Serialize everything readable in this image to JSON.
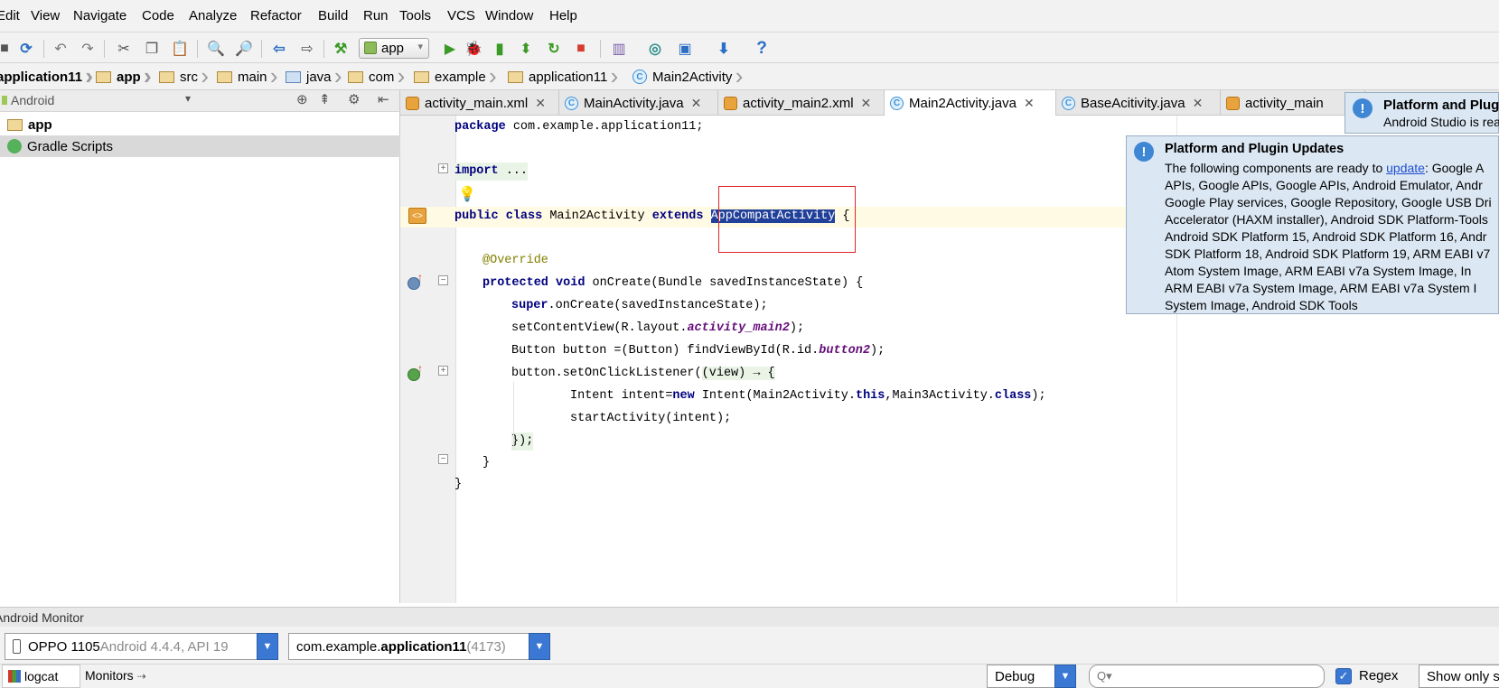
{
  "menu": [
    "Edit",
    "View",
    "Navigate",
    "Code",
    "Analyze",
    "Refactor",
    "Build",
    "Run",
    "Tools",
    "VCS",
    "Window",
    "Help"
  ],
  "menu_display": [
    "Edit",
    "View",
    "Navigate",
    "Code",
    "Analyze",
    "Refactor",
    "Build",
    "Run",
    "Tools",
    "VCS",
    "Window",
    "Help"
  ],
  "toolbar": {
    "run_config": "app",
    "help": "?"
  },
  "breadcrumbs": [
    "application11",
    "app",
    "src",
    "main",
    "java",
    "com",
    "example",
    "application11",
    "Main2Activity"
  ],
  "project_view": {
    "mode": "Android",
    "items": [
      "app",
      "Gradle Scripts"
    ]
  },
  "tabs": [
    "activity_main.xml",
    "MainActivity.java",
    "activity_main2.xml",
    "Main2Activity.java",
    "BaseAcitivity.java",
    "activity_main"
  ],
  "active_tab": "Main2Activity.java",
  "code": {
    "l1_kw": "package",
    "l1_rest": " com.example.application11;",
    "l2_kw": "import",
    "l2_rest": " ...",
    "l3_kw1": "public class",
    "l3_name": " Main2Activity ",
    "l3_kw2": "extends",
    "l3_sel": "AppCompatActivity",
    "l3_end": " {",
    "l4": "@Override",
    "l5_kw": "protected void",
    "l5_rest": " onCreate(Bundle savedInstanceState) {",
    "l6_kw": "super",
    "l6_rest": ".onCreate(savedInstanceState);",
    "l7_a": "setContentView(R.layout.",
    "l7_fld": "activity_main2",
    "l7_b": ");",
    "l8_a": "Button button =(Button) findViewById(R.id.",
    "l8_fld": "button2",
    "l8_b": ");",
    "l9_a": "button.setOnClickListener(",
    "l9_b": "(view) → {",
    "l10_a": "Intent intent=",
    "l10_kw1": "new",
    "l10_b": " Intent(Main2Activity.",
    "l10_kw2": "this",
    "l10_c": ",Main3Activity.",
    "l10_kw3": "class",
    "l10_d": ");",
    "l11": "startActivity(intent);",
    "l12": "});",
    "l13": "}",
    "l14": "}"
  },
  "notification_small": {
    "title": "Platform and Plug",
    "body": "Android Studio is rea"
  },
  "notification": {
    "title": "Platform and Plugin Updates",
    "text_before_link": "The following components are ready to ",
    "link": "update",
    "lines": [
      ": Google A",
      "APIs, Google APIs, Google APIs, Android Emulator, Andr",
      "Google Play services, Google Repository, Google USB Dri",
      "Accelerator (HAXM installer), Android SDK Platform-Tools",
      "Android SDK Platform 15, Android SDK Platform 16, Andr",
      "SDK Platform 18, Android SDK Platform 19, ARM EABI v7",
      "Atom System Image, ARM EABI v7a System Image, In",
      "ARM EABI v7a System Image, ARM EABI v7a System I",
      "System Image, Android SDK Tools"
    ]
  },
  "monitor": {
    "title": "Android Monitor",
    "device_name": "OPPO 1105",
    "device_info": " Android 4.4.4, API 19",
    "process_prefix": "com.example.",
    "process_bold": "application11",
    "process_pid": " (4173)",
    "tabs": [
      "logcat",
      "Monitors"
    ],
    "log_level": "Debug",
    "search_placeholder": "Q▾",
    "regex_label": "Regex",
    "show_only": "Show only s"
  }
}
